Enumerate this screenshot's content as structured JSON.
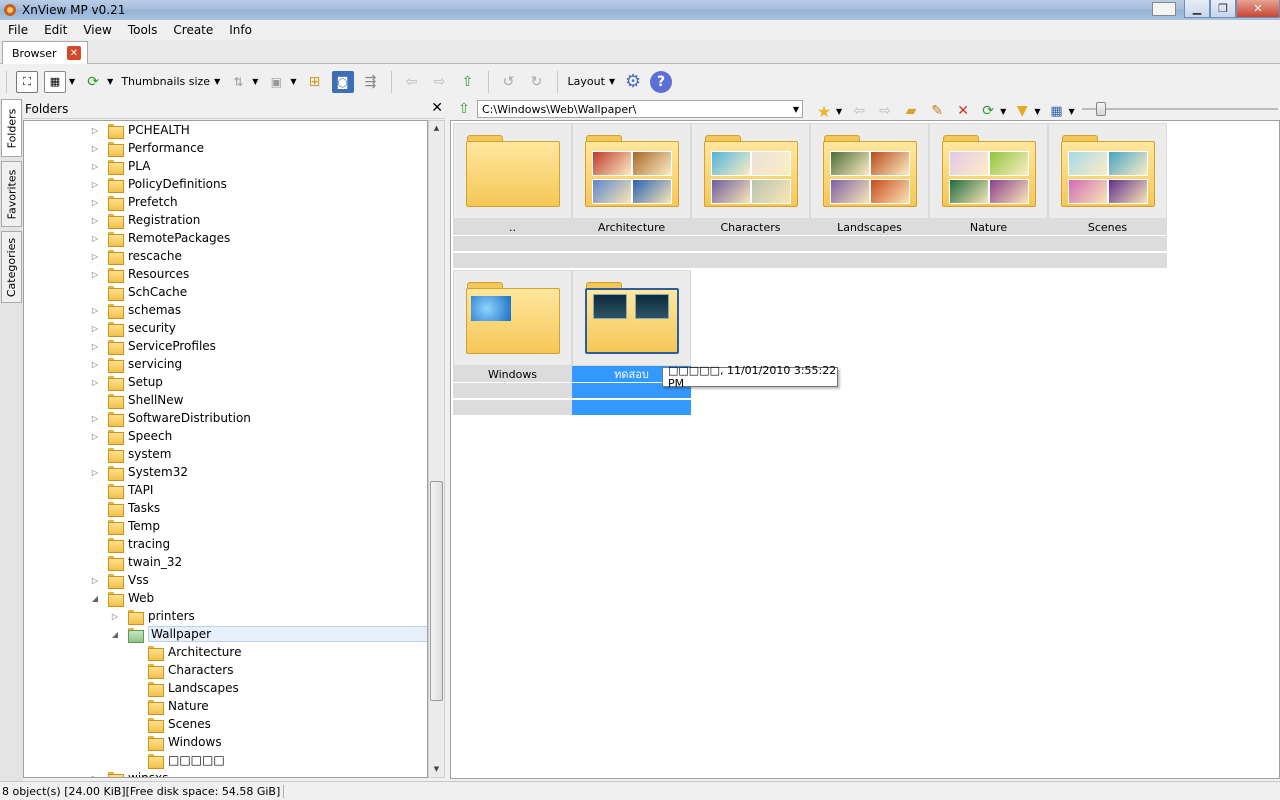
{
  "window": {
    "title": "XnView MP v0.21"
  },
  "menu": [
    "File",
    "Edit",
    "View",
    "Tools",
    "Create",
    "Info"
  ],
  "tabs": [
    {
      "label": "Browser"
    }
  ],
  "toolbar": {
    "thumbnails_size_label": "Thumbnails size",
    "layout_label": "Layout"
  },
  "side_tabs": [
    "Folders",
    "Favorites",
    "Categories"
  ],
  "folders_panel": {
    "title": "Folders",
    "close": "✕",
    "items": [
      {
        "label": "PCHEALTH",
        "level": 0,
        "expander": "▷"
      },
      {
        "label": "Performance",
        "level": 0,
        "expander": "▷"
      },
      {
        "label": "PLA",
        "level": 0,
        "expander": "▷"
      },
      {
        "label": "PolicyDefinitions",
        "level": 0,
        "expander": "▷"
      },
      {
        "label": "Prefetch",
        "level": 0,
        "expander": "▷"
      },
      {
        "label": "Registration",
        "level": 0,
        "expander": "▷"
      },
      {
        "label": "RemotePackages",
        "level": 0,
        "expander": "▷"
      },
      {
        "label": "rescache",
        "level": 0,
        "expander": "▷"
      },
      {
        "label": "Resources",
        "level": 0,
        "expander": "▷"
      },
      {
        "label": "SchCache",
        "level": 0,
        "expander": ""
      },
      {
        "label": "schemas",
        "level": 0,
        "expander": "▷"
      },
      {
        "label": "security",
        "level": 0,
        "expander": "▷"
      },
      {
        "label": "ServiceProfiles",
        "level": 0,
        "expander": "▷"
      },
      {
        "label": "servicing",
        "level": 0,
        "expander": "▷"
      },
      {
        "label": "Setup",
        "level": 0,
        "expander": "▷"
      },
      {
        "label": "ShellNew",
        "level": 0,
        "expander": ""
      },
      {
        "label": "SoftwareDistribution",
        "level": 0,
        "expander": "▷"
      },
      {
        "label": "Speech",
        "level": 0,
        "expander": "▷"
      },
      {
        "label": "system",
        "level": 0,
        "expander": ""
      },
      {
        "label": "System32",
        "level": 0,
        "expander": "▷"
      },
      {
        "label": "TAPI",
        "level": 0,
        "expander": ""
      },
      {
        "label": "Tasks",
        "level": 0,
        "expander": ""
      },
      {
        "label": "Temp",
        "level": 0,
        "expander": ""
      },
      {
        "label": "tracing",
        "level": 0,
        "expander": ""
      },
      {
        "label": "twain_32",
        "level": 0,
        "expander": ""
      },
      {
        "label": "Vss",
        "level": 0,
        "expander": "▷"
      },
      {
        "label": "Web",
        "level": 0,
        "expander": "◢"
      },
      {
        "label": "printers",
        "level": 1,
        "expander": "▷"
      },
      {
        "label": "Wallpaper",
        "level": 1,
        "expander": "◢",
        "selected": true
      },
      {
        "label": "Architecture",
        "level": 2,
        "expander": ""
      },
      {
        "label": "Characters",
        "level": 2,
        "expander": ""
      },
      {
        "label": "Landscapes",
        "level": 2,
        "expander": ""
      },
      {
        "label": "Nature",
        "level": 2,
        "expander": ""
      },
      {
        "label": "Scenes",
        "level": 2,
        "expander": ""
      },
      {
        "label": "Windows",
        "level": 2,
        "expander": ""
      },
      {
        "label": "□□□□□",
        "level": 2,
        "expander": ""
      },
      {
        "label": "winsxs",
        "level": 0,
        "expander": "▷"
      }
    ]
  },
  "address": {
    "path": "C:\\Windows\\Web\\Wallpaper\\"
  },
  "thumbnails": [
    {
      "label": "..",
      "kind": "empty"
    },
    {
      "label": "Architecture",
      "kind": "preview",
      "colors": [
        "#c0392b",
        "#a7662b",
        "#5d86c9",
        "#2a62b5"
      ]
    },
    {
      "label": "Characters",
      "kind": "preview",
      "colors": [
        "#4fb3d8",
        "#e8e2d6",
        "#6d5d9e",
        "#b9c2b3"
      ]
    },
    {
      "label": "Landscapes",
      "kind": "preview",
      "colors": [
        "#4e6b38",
        "#b84a1c",
        "#7d5fa3",
        "#c8491e"
      ]
    },
    {
      "label": "Nature",
      "kind": "preview",
      "colors": [
        "#e3c8e6",
        "#8fc43a",
        "#1d6b3f",
        "#8a3f8e"
      ]
    },
    {
      "label": "Scenes",
      "kind": "preview",
      "colors": [
        "#a6d7e8",
        "#47a4c4",
        "#d06ab3",
        "#5f2f8a"
      ]
    },
    {
      "label": "Windows",
      "kind": "windows",
      "colors": [
        "#1a6fc4"
      ]
    },
    {
      "label": "ทดสอบ",
      "kind": "selected",
      "colors": [
        "#0e2a3a",
        "#0e2a3a"
      ],
      "selected": true
    }
  ],
  "tooltip": {
    "text": "□□□□□, 11/01/2010 3:55:22 PM"
  },
  "status": {
    "text": "8 object(s) [24.00 KiB][Free disk space: 54.58 GiB]"
  }
}
